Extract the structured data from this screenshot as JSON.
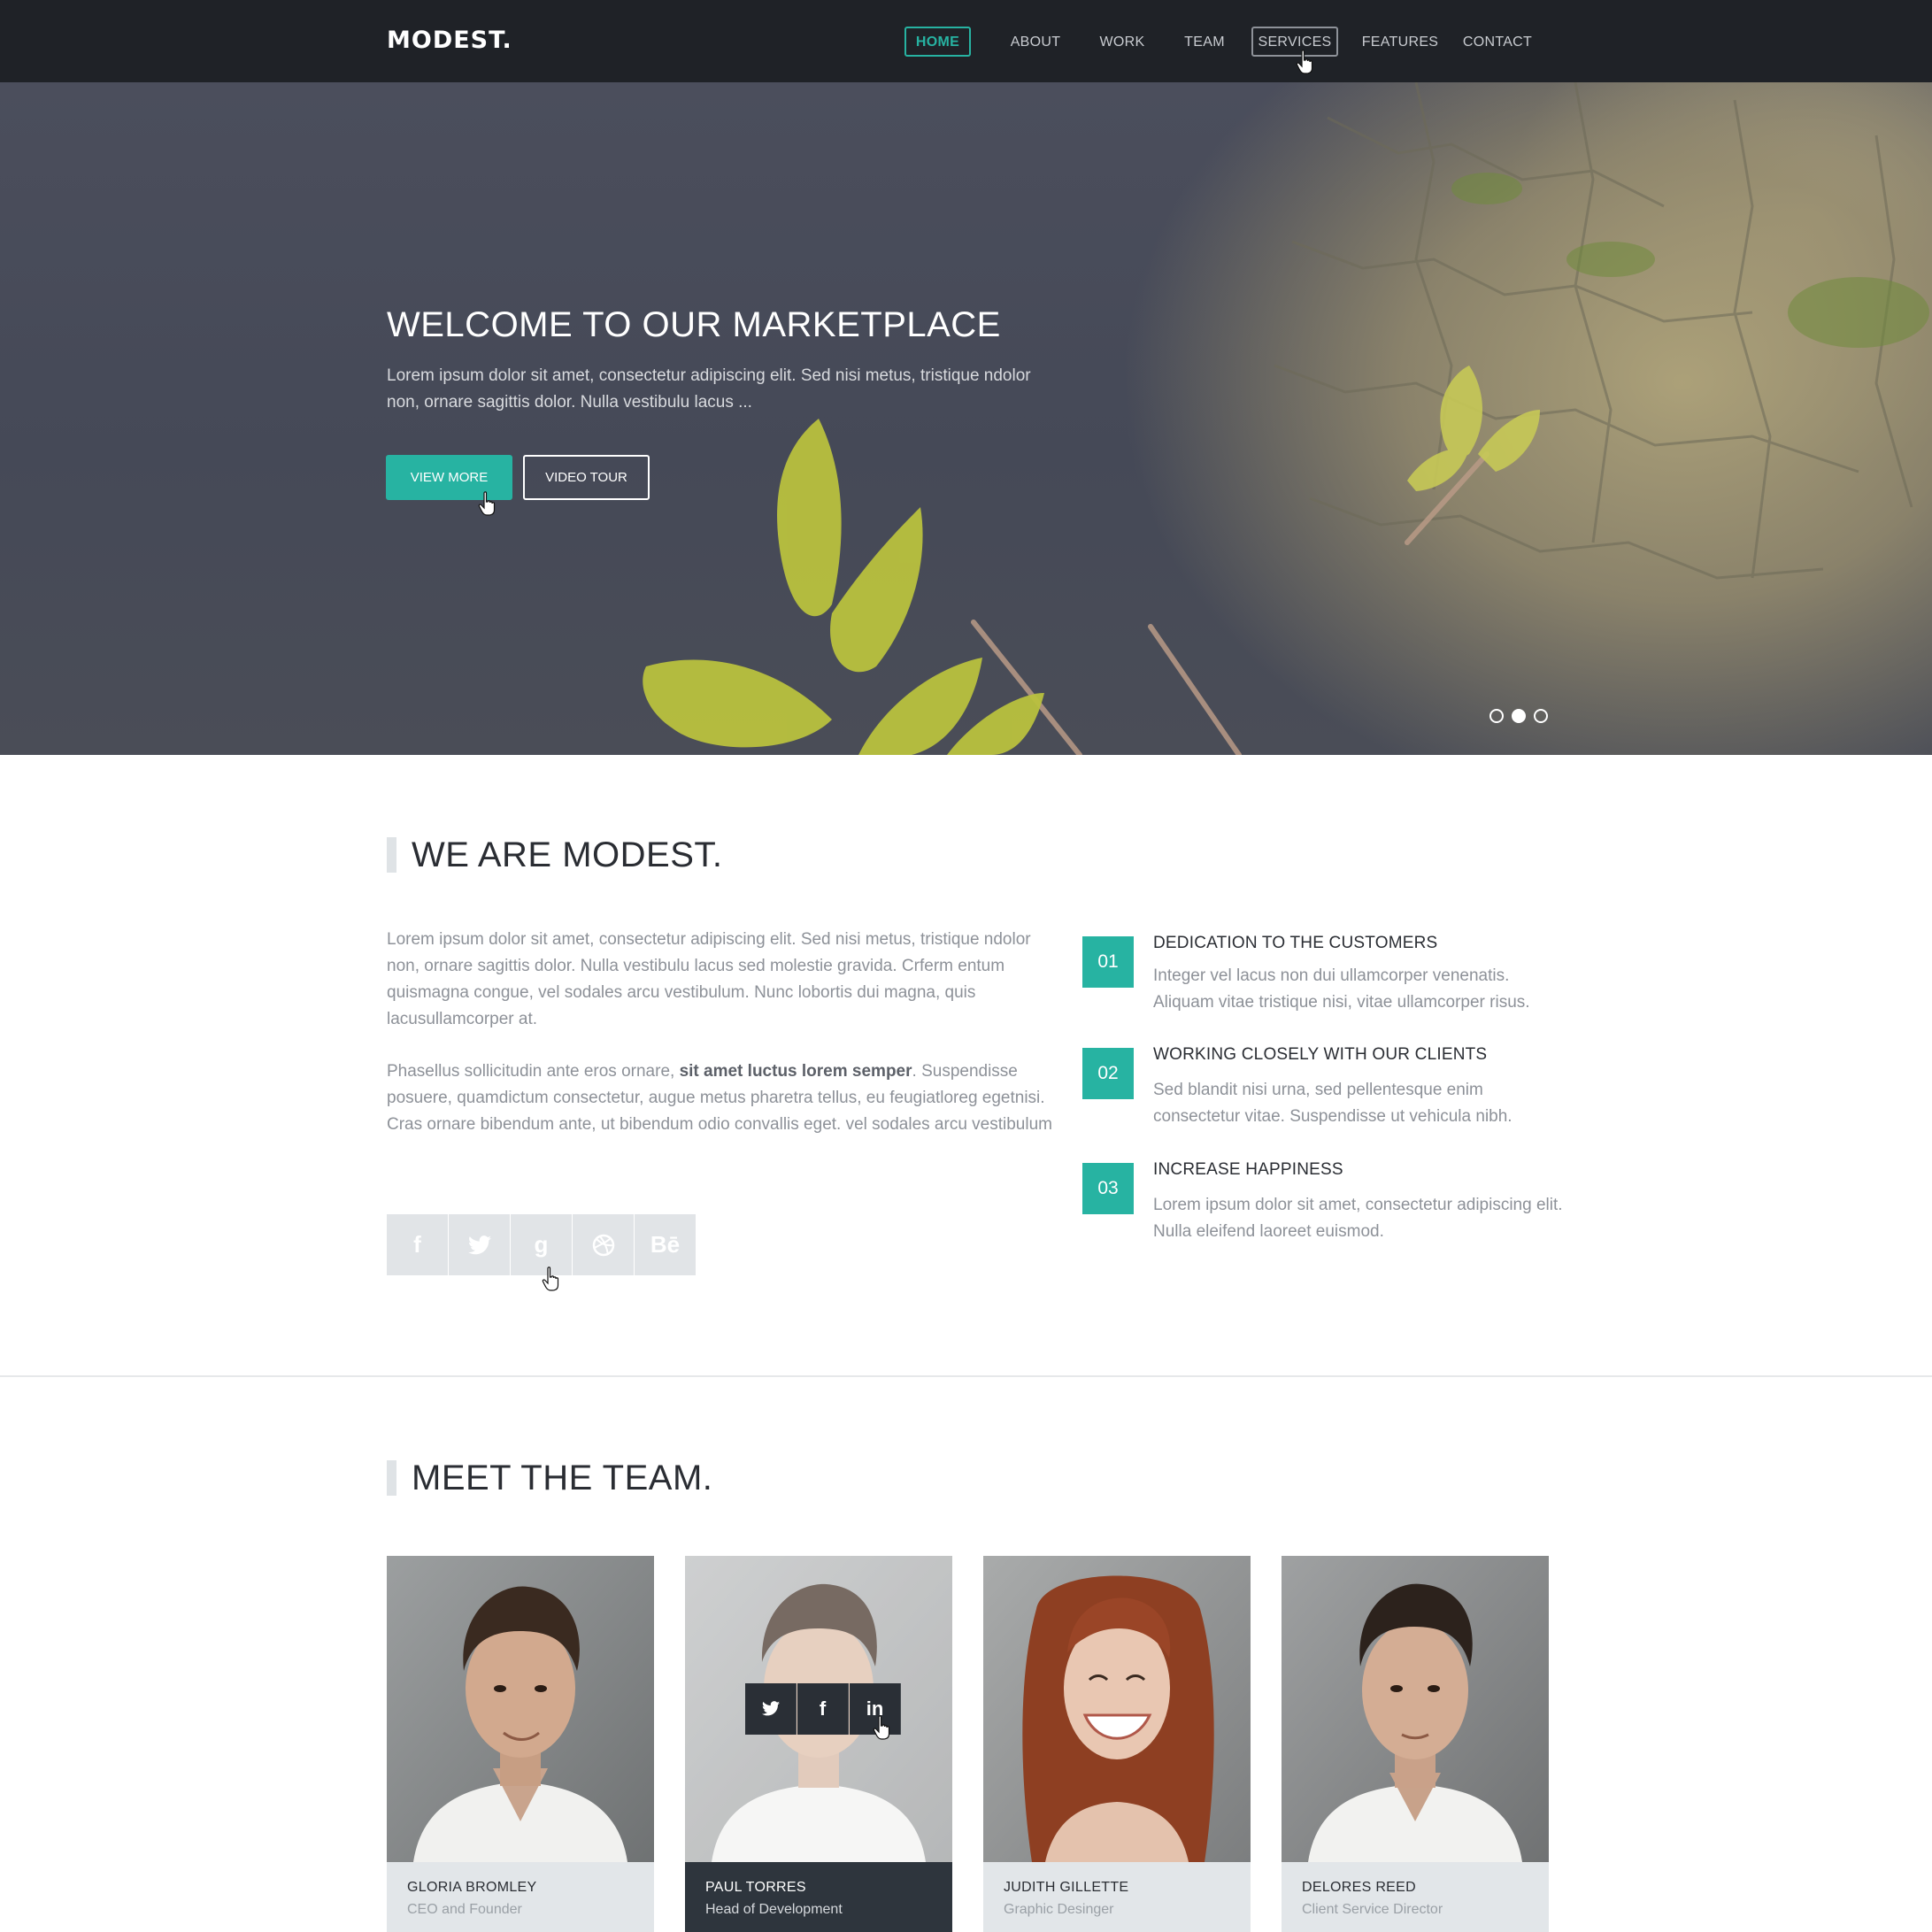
{
  "header": {
    "logo": "MODEST.",
    "nav": [
      {
        "label": "HOME"
      },
      {
        "label": "ABOUT"
      },
      {
        "label": "WORK"
      },
      {
        "label": "TEAM"
      },
      {
        "label": "SERVICES"
      },
      {
        "label": "FEATURES"
      },
      {
        "label": "CONTACT"
      }
    ],
    "active_item": "HOME"
  },
  "hero": {
    "title": "WELCOME TO OUR MARKETPLACE",
    "text": "Lorem ipsum dolor sit amet, consectetur adipiscing elit. Sed nisi metus, tristique ndolor non, ornare sagittis dolor. Nulla vestibulu lacus ...",
    "primary_button": "VIEW MORE",
    "secondary_button": "VIDEO TOUR",
    "slides": 3,
    "active_slide": 2
  },
  "about": {
    "title": "WE ARE MODEST.",
    "paragraph1": "Lorem ipsum dolor sit amet, consectetur adipiscing elit. Sed nisi metus, tristique ndolor non, ornare sagittis dolor. Nulla vestibulu lacus sed molestie gravida. Crferm entum quismagna congue, vel sodales arcu vestibulum. Nunc lobortis dui magna, quis lacusullamcorper at.",
    "paragraph2_start": "Phasellus sollicitudin ante eros ornare, ",
    "paragraph2_bold": "sit amet luctus lorem semper",
    "paragraph2_end": ". Suspendisse posuere, quamdictum consectetur, augue metus pharetra tellus, eu feugiatloreg egetnisi. Cras ornare bibendum ante, ut bibendum odio convallis eget. vel sodales arcu vestibulum",
    "social": [
      {
        "icon": "facebook-icon",
        "glyph": "f"
      },
      {
        "icon": "twitter-icon",
        "glyph": "🐦"
      },
      {
        "icon": "google-icon",
        "glyph": "g"
      },
      {
        "icon": "dribbble-icon",
        "glyph": "◎"
      },
      {
        "icon": "behance-icon",
        "glyph": "Bē"
      }
    ],
    "features": [
      {
        "num": "01",
        "title": "DEDICATION TO THE CUSTOMERS",
        "text": "Integer vel lacus non dui ullamcorper venenatis. Aliquam vitae tristique nisi, vitae ullamcorper risus."
      },
      {
        "num": "02",
        "title": "WORKING CLOSELY WITH OUR CLIENTS",
        "text": "Sed blandit nisi urna, sed pellentesque enim consectetur vitae. Suspendisse ut vehicula nibh."
      },
      {
        "num": "03",
        "title": "INCREASE HAPPINESS",
        "text": "Lorem ipsum dolor sit amet, consectetur adipiscing elit. Nulla eleifend laoreet euismod."
      }
    ]
  },
  "team": {
    "title": "MEET THE TEAM.",
    "members": [
      {
        "name": "GLORIA BROMLEY",
        "role": "CEO and Founder"
      },
      {
        "name": "PAUL TORRES",
        "role": "Head of Development"
      },
      {
        "name": "JUDITH GILLETTE",
        "role": "Graphic Desinger"
      },
      {
        "name": "DELORES REED",
        "role": "Client Service Director"
      }
    ],
    "hover_social": [
      {
        "icon": "twitter-icon",
        "glyph": "🐦"
      },
      {
        "icon": "facebook-icon",
        "glyph": "f"
      },
      {
        "icon": "linkedin-icon",
        "glyph": "in"
      }
    ]
  },
  "colors": {
    "accent": "#27b3a2",
    "nav_bg": "#1f2227",
    "text_dark": "#2a2d33",
    "text_muted": "#8d9198"
  }
}
